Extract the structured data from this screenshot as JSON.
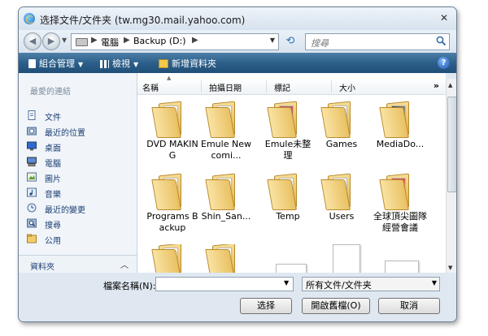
{
  "window": {
    "title": "选择文件/文件夹 (tw.mg30.mail.yahoo.com)",
    "close_glyph": "✕"
  },
  "address": {
    "back_glyph": "◀",
    "forward_glyph": "▶",
    "crumbs": [
      "電腦",
      "Backup (D:)"
    ],
    "separator": "▶",
    "search_placeholder": "搜尋"
  },
  "toolbar": {
    "organize": "組合管理",
    "views": "檢視",
    "new_folder": "新增資料夾",
    "help": "?"
  },
  "sidebar": {
    "section_title": "最愛的連結",
    "items": [
      {
        "label": "文件",
        "icon": "document-icon"
      },
      {
        "label": "最近的位置",
        "icon": "recent-places-icon"
      },
      {
        "label": "桌面",
        "icon": "desktop-icon"
      },
      {
        "label": "電腦",
        "icon": "computer-icon"
      },
      {
        "label": "圖片",
        "icon": "pictures-icon"
      },
      {
        "label": "音樂",
        "icon": "music-icon"
      },
      {
        "label": "最近的變更",
        "icon": "recently-changed-icon"
      },
      {
        "label": "搜尋",
        "icon": "search-folder-icon"
      },
      {
        "label": "公用",
        "icon": "public-folder-icon"
      }
    ],
    "folders_label": "資料夾",
    "folders_chevron": "︿"
  },
  "columns": [
    "名稱",
    "拍攝日期",
    "標記",
    "大小"
  ],
  "more_columns": "»",
  "files": [
    {
      "name": "DVD MAKING",
      "kind": "folder"
    },
    {
      "name": "Emule Newcomi...",
      "kind": "folder"
    },
    {
      "name": "Emule未整理",
      "kind": "folder"
    },
    {
      "name": "Games",
      "kind": "folder"
    },
    {
      "name": "MediaDo...",
      "kind": "folder"
    },
    {
      "name": "Programs Backup",
      "kind": "folder"
    },
    {
      "name": "Shin_San...",
      "kind": "folder"
    },
    {
      "name": "Temp",
      "kind": "folder"
    },
    {
      "name": "Users",
      "kind": "folder"
    },
    {
      "name": "全球頂尖圖隊經營會議",
      "kind": "folder"
    },
    {
      "name": "",
      "kind": "folder"
    },
    {
      "name": "",
      "kind": "folder"
    },
    {
      "name": "",
      "kind": "doc"
    },
    {
      "name": "",
      "kind": "doc"
    },
    {
      "name": "",
      "kind": "doc"
    }
  ],
  "bottom": {
    "filename_label": "檔案名稱(N):",
    "filename_value": "",
    "filetype_value": "所有文件/文件夹",
    "select_button": "选择",
    "open_readonly_button": "開啟舊檔(O)",
    "cancel_button": "取消"
  },
  "colors": {
    "toolbar": "#2c5f8a",
    "link_text": "#1b3e73",
    "folder": "#e9c163"
  }
}
